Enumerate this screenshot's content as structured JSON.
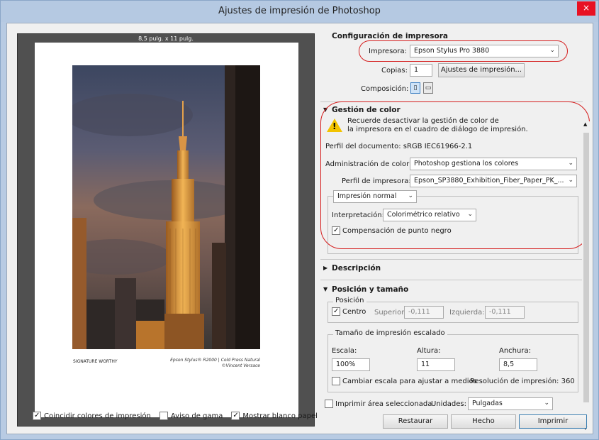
{
  "window": {
    "title": "Ajustes de impresión de Photoshop",
    "close_label": "×"
  },
  "preview": {
    "paper_size": "8,5 pulg. x 11 pulg.",
    "signature_text": "SIGNATURE WORTHY",
    "caption_line1": "Epson Stylus® R2000 | Cold Press Natural",
    "caption_line2": "©Vincent Versace"
  },
  "bottom_options": {
    "match_colors": {
      "label": "Coincidir colores de impresión",
      "checked": true
    },
    "gamut_warning": {
      "label": "Aviso de gama",
      "checked": false
    },
    "show_white": {
      "label": "Mostrar blanco papel",
      "checked": true
    }
  },
  "printer_setup": {
    "title": "Configuración de impresora",
    "printer_label": "Impresora:",
    "printer_value": "Epson Stylus Pro 3880",
    "copies_label": "Copias:",
    "copies_value": "1",
    "print_settings_button": "Ajustes de impresión...",
    "layout_label": "Composición:",
    "layout_icons": [
      "portrait-icon",
      "landscape-icon"
    ]
  },
  "color_management": {
    "title": "Gestión de color",
    "warning_line1": "Recuerde desactivar la gestión de color de",
    "warning_line2": "la impresora en el cuadro de diálogo de impresión.",
    "doc_profile": "Perfil del documento: sRGB IEC61966-2.1",
    "color_handling_label": "Administración de color:",
    "color_handling_value": "Photoshop gestiona los colores",
    "printer_profile_label": "Perfil de impresora:",
    "printer_profile_value": "Epson_SP3880_Exhibition_Fiber_Paper_PK_...",
    "mode_value": "Impresión normal",
    "rendering_label": "Interpretación:",
    "rendering_value": "Colorimétrico relativo",
    "bpc_label": "Compensación de punto negro",
    "bpc_checked": true
  },
  "description": {
    "title": "Descripción"
  },
  "position_size": {
    "title": "Posición y tamaño",
    "position_group": "Posición",
    "center_label": "Centro",
    "center_checked": true,
    "top_label": "Superior:",
    "top_value": "-0,111",
    "left_label": "Izquierda:",
    "left_value": "-0,111",
    "scaled_group": "Tamaño de impresión escalado",
    "scale_label": "Escala:",
    "scale_value": "100%",
    "height_label": "Altura:",
    "height_value": "11",
    "width_label": "Anchura:",
    "width_value": "8,5",
    "scale_to_fit_label": "Cambiar escala para ajustar a medios",
    "scale_to_fit_checked": false,
    "resolution_text": "Resolución de impresión: 360",
    "print_selected_label": "Imprimir área seleccionada",
    "print_selected_checked": false,
    "units_label": "Unidades:",
    "units_value": "Pulgadas"
  },
  "footer_buttons": {
    "reset": "Restaurar",
    "done": "Hecho",
    "print": "Imprimir"
  },
  "colors": {
    "annotation_red": "#d51d1d",
    "warning_yellow": "#f2c300",
    "title_bar": "#b5c9e2"
  }
}
